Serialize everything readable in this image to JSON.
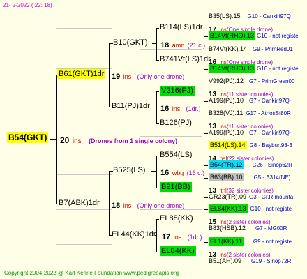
{
  "header": {
    "date": "21-  2-2022 (  22:  18)"
  },
  "footer": {
    "copyright": "Copyright 2004-2022 @ Karl Kehrle Foundation    www.pedigreeapis.org"
  },
  "root": {
    "id": "B54(GKT)",
    "ins": "20",
    "ins_unit": "ins",
    "note": "(Drones from 1 single colony)"
  },
  "gen1": {
    "father": {
      "id": "B61(GKT)1dr",
      "ins": "19",
      "ins_unit": "ins",
      "note": "(Only one drone)"
    },
    "mother": {
      "id": "B7(ABK)1dr",
      "ins": "18",
      "ins_unit": "ins",
      "note": "(Only one drone)"
    }
  },
  "gen2": {
    "b10": {
      "id": "B10(GKT)",
      "ins": "18",
      "ins_unit": "amn",
      "note": "(21 c.)"
    },
    "b11": {
      "id": "B11(PJ)1dr",
      "ins": "16",
      "ins_unit": "ins",
      "note": "(1dr.)"
    },
    "b525": {
      "id": "B525(LS)",
      "ins": "16",
      "ins_unit": "wbg",
      "note": "(16 c.)"
    },
    "el44": {
      "id": "EL44(KK)1dr",
      "ins": "17",
      "ins_unit": "ins",
      "note": "(1dr.)"
    }
  },
  "gen3": {
    "b114": {
      "id": "B114(LS)1dr"
    },
    "b741": {
      "id": "B741Vt(LS)1dr"
    },
    "v216": {
      "id": "V216(PJ)"
    },
    "b126": {
      "id": "B126(PJ)"
    },
    "b554": {
      "id": "B554(LS)"
    },
    "b91": {
      "id": "B91(BB)"
    },
    "el88": {
      "id": "EL88(KK)"
    },
    "el84": {
      "id": "EL84(KK)"
    }
  },
  "gen4": [
    {
      "id": "B35(LS).15",
      "info": "G10 - Cankiri97Q"
    },
    {
      "ins": "17",
      "ins_unit": "ins",
      "note": "(One single drone)"
    },
    {
      "id": "B14Vt(RHO).13",
      "info": "G10 - not registe"
    },
    {
      "id": "B74Vt(KK).14",
      "info": "G9 - PrimRed01"
    },
    {
      "ins": "16",
      "ins_unit": "ins",
      "note": "(One single drone)"
    },
    {
      "id": "B14Vt(RHO).13",
      "info": "G10 - not registe"
    },
    {
      "id": "V992(PJ).12",
      "info": "G7 - PrimGreen00"
    },
    {
      "ins": "13",
      "ins_unit": "ins",
      "note": "(11 sister colonies)"
    },
    {
      "id": "A199(PJ).10",
      "info": "G7 - Cankiri97Q"
    },
    {
      "id": "B328(VJ).11",
      "info": "G17 - AthosSt80R"
    },
    {
      "ins": "13",
      "ins_unit": "ins",
      "note": "(11 sister colonies)"
    },
    {
      "id": "A199(PJ).10",
      "info": "G7 - Cankiri97Q"
    },
    {
      "id": "B514(LS).14",
      "info": "G8 - Bayburt98-3"
    },
    {
      "ins": "14",
      "ins_unit": "bal",
      "note": "(22 sister colonies)"
    },
    {
      "id": "B54(TR).12",
      "info": "G26 - Sinop62R"
    },
    {
      "id": "B63(BB).10",
      "info": "G5 - B314(NE)"
    },
    {
      "ins": "13",
      "ins_unit": "lthl",
      "note": "(32 sister colonies)"
    },
    {
      "id": "GR23(TR).09",
      "info": "G3 - Gr.R.mounta"
    },
    {
      "id": "EL84(KK).13",
      "info": "G10 - not registe"
    },
    {
      "ins": "15",
      "ins_unit": "ins",
      "note": "(2 sister colonies)"
    },
    {
      "id": "B83(HSB).12",
      "info": "G7 - MG00R"
    },
    {
      "id": "EL1(KK).11",
      "info": "G9 - not registe"
    },
    {
      "ins": "13",
      "ins_unit": "ins",
      "note": "(2 sister colonies)"
    },
    {
      "id": "B51(AH).09",
      "info": "G19 - Sinop72R"
    }
  ],
  "colors": {
    "green_highlight": "#00dd00",
    "yellow_highlight": "#ffff00",
    "cyan_highlight": "#00e0ff",
    "grey_highlight": "#c0c0c0",
    "ins_red": "#cc0000",
    "note_purple": "#9900cc",
    "info_blue": "#0000cc",
    "header_magenta": "#cc00cc",
    "footer_green": "#009900"
  }
}
